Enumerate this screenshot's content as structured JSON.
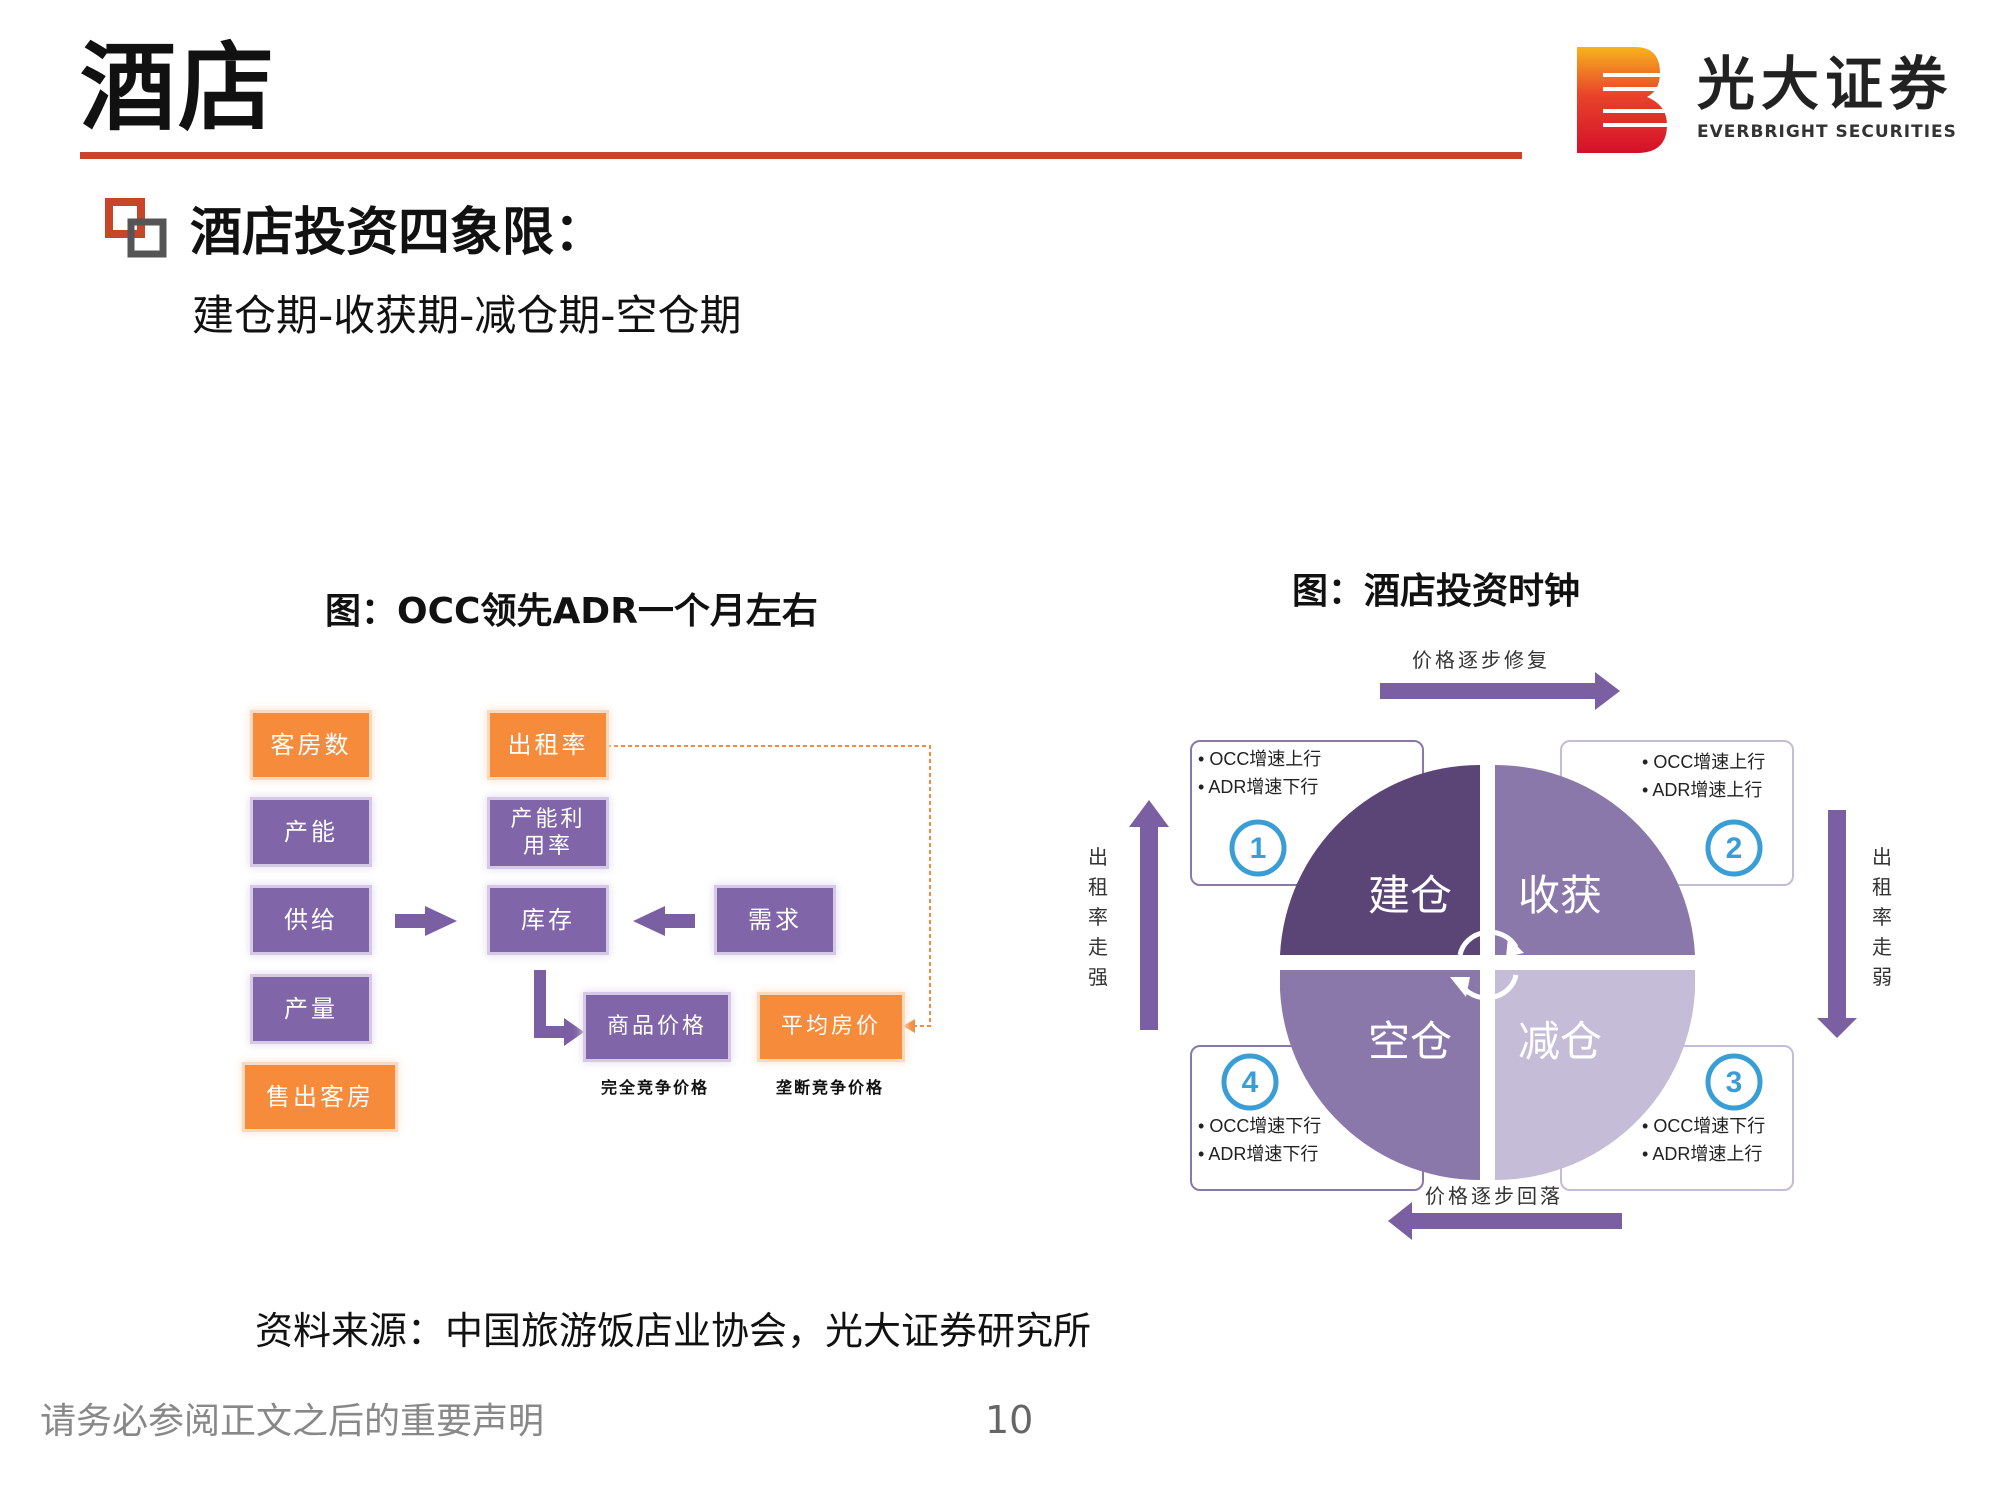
{
  "header": {
    "title": "酒店"
  },
  "logo": {
    "name_cn": "光大证券",
    "name_en": "EVERBRIGHT SECURITIES",
    "colors": [
      "#f7b31c",
      "#e8442a",
      "#d5102a"
    ]
  },
  "section": {
    "heading": "酒店投资四象限：",
    "subheading": "建仓期-收获期-减仓期-空仓期"
  },
  "figure1": {
    "caption": "图：OCC领先ADR一个月左右",
    "boxes": {
      "rooms": "客房数",
      "capacity": "产能",
      "supply": "供给",
      "output": "产量",
      "sold_rooms": "售出客房",
      "occupancy": "出租率",
      "utilization": "产能利用率",
      "inventory": "库存",
      "demand": "需求",
      "commodity_price": "商品价格",
      "avg_room_price": "平均房价"
    },
    "notes": {
      "perfect_competition": "完全竞争价格",
      "monopolistic_competition": "垄断竞争价格"
    },
    "colors": {
      "orange": "#f68b3c",
      "purple": "#8066a8",
      "arrow": "#7a5fa3",
      "dotted": "#f68b3c"
    }
  },
  "figure2": {
    "caption": "图：酒店投资时钟",
    "quadrants": {
      "q1": "建仓",
      "q2": "收获",
      "q3": "减仓",
      "q4": "空仓"
    },
    "callouts": {
      "q1": {
        "number": "1",
        "lines": [
          "OCC增速上行",
          "ADR增速下行"
        ]
      },
      "q2": {
        "number": "2",
        "lines": [
          "OCC增速上行",
          "ADR增速上行"
        ]
      },
      "q3": {
        "number": "3",
        "lines": [
          "OCC增速下行",
          "ADR增速上行"
        ]
      },
      "q4": {
        "number": "4",
        "lines": [
          "OCC增速下行",
          "ADR增速下行"
        ]
      }
    },
    "arrows": {
      "top": "价格逐步修复",
      "bottom": "价格逐步回落",
      "left": "出租率走强",
      "right": "出租率走弱"
    },
    "colors": {
      "q1": "#5b4577",
      "q2": "#8a78ab",
      "q3": "#c5bcd8",
      "q4": "#8a78ab",
      "circle_num": "#3a9ed6",
      "arrow": "#7a5fa3"
    }
  },
  "source": "资料来源：中国旅游饭店业协会，光大证券研究所",
  "footer": {
    "disclaimer": "请务必参阅正文之后的重要声明",
    "page_number": "10"
  }
}
